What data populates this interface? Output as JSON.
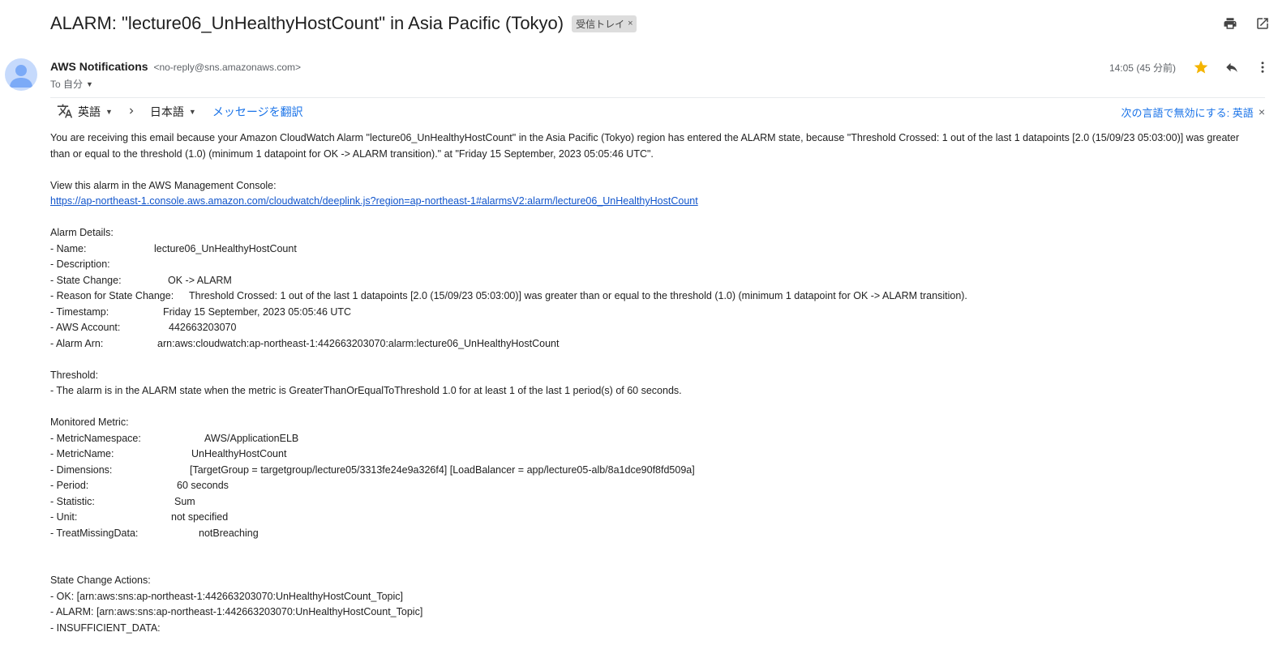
{
  "subject": "ALARM: \"lecture06_UnHealthyHostCount\" in Asia Pacific (Tokyo)",
  "label_chip": "受信トレイ",
  "sender": {
    "name": "AWS Notifications",
    "email": "<no-reply@sns.amazonaws.com>",
    "to": "To 自分"
  },
  "time": "14:05 (45 分前)",
  "translate": {
    "source_lang": "英語",
    "target_lang": "日本語",
    "translate_link": "メッセージを翻訳",
    "disable_text": "次の言語で無効にする: 英語"
  },
  "body": {
    "intro": "You are receiving this email because your Amazon CloudWatch Alarm \"lecture06_UnHealthyHostCount\" in the Asia Pacific (Tokyo) region has entered the ALARM state, because \"Threshold Crossed: 1 out of the last 1 datapoints [2.0 (15/09/23 05:03:00)] was greater than or equal to the threshold (1.0) (minimum 1 datapoint for OK -> ALARM transition).\" at \"Friday 15 September, 2023 05:05:46 UTC\".",
    "console_label": "View this alarm in the AWS Management Console:",
    "console_link": "https://ap-northeast-1.console.aws.amazon.com/cloudwatch/deeplink.js?region=ap-northeast-1#alarmsV2:alarm/lecture06_UnHealthyHostCount",
    "alarm_details_heading": "Alarm Details:",
    "alarm_details": [
      {
        "key": "- Name:",
        "value": "lecture06_UnHealthyHostCount"
      },
      {
        "key": "- Description:",
        "value": ""
      },
      {
        "key": "- State Change:",
        "value": "OK -> ALARM"
      },
      {
        "key": "- Reason for State Change:",
        "value": "Threshold Crossed: 1 out of the last 1 datapoints [2.0 (15/09/23 05:03:00)] was greater than or equal to the threshold (1.0) (minimum 1 datapoint for OK -> ALARM transition)."
      },
      {
        "key": "- Timestamp:",
        "value": "Friday 15 September, 2023 05:05:46 UTC"
      },
      {
        "key": "- AWS Account:",
        "value": "442663203070"
      },
      {
        "key": "- Alarm Arn:",
        "value": "arn:aws:cloudwatch:ap-northeast-1:442663203070:alarm:lecture06_UnHealthyHostCount"
      }
    ],
    "threshold_heading": "Threshold:",
    "threshold_text": "- The alarm is in the ALARM state when the metric is GreaterThanOrEqualToThreshold 1.0 for at least 1 of the last 1 period(s) of 60 seconds.",
    "metric_heading": "Monitored Metric:",
    "metric_details": [
      {
        "key": "- MetricNamespace:",
        "value": "AWS/ApplicationELB"
      },
      {
        "key": "- MetricName:",
        "value": "UnHealthyHostCount"
      },
      {
        "key": "- Dimensions:",
        "value": "[TargetGroup = targetgroup/lecture05/3313fe24e9a326f4] [LoadBalancer = app/lecture05-alb/8a1dce90f8fd509a]"
      },
      {
        "key": "- Period:",
        "value": "60 seconds"
      },
      {
        "key": "- Statistic:",
        "value": "Sum"
      },
      {
        "key": "- Unit:",
        "value": "not specified"
      },
      {
        "key": "- TreatMissingData:",
        "value": "notBreaching"
      }
    ],
    "actions_heading": "State Change Actions:",
    "actions": [
      "- OK: [arn:aws:sns:ap-northeast-1:442663203070:UnHealthyHostCount_Topic]",
      "- ALARM: [arn:aws:sns:ap-northeast-1:442663203070:UnHealthyHostCount_Topic]",
      "- INSUFFICIENT_DATA:"
    ]
  }
}
